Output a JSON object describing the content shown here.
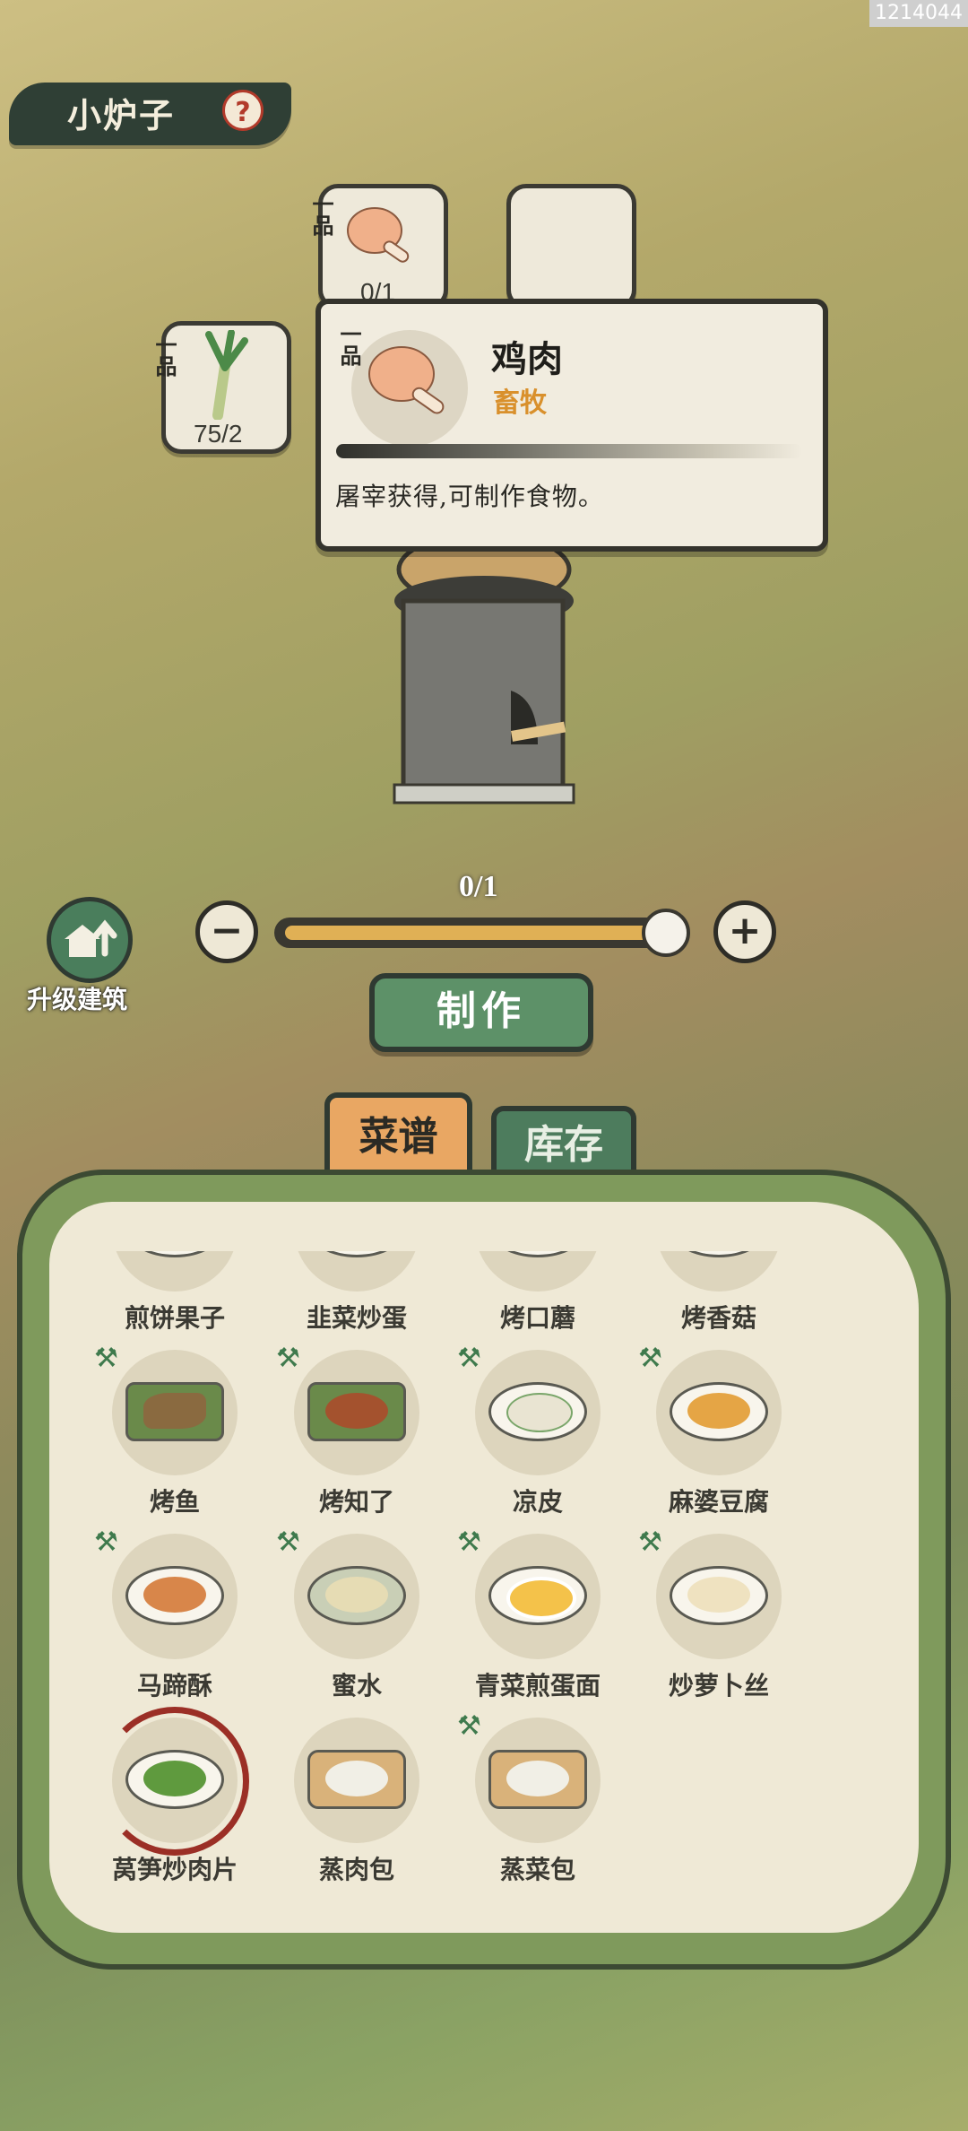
{
  "watermark": "1214044",
  "header": {
    "title": "小炉子",
    "help_icon": "help-icon"
  },
  "slots": [
    {
      "grade": "一品",
      "item": "鸡肉",
      "count": "0/1",
      "icon": "chicken-leg-icon"
    },
    {
      "grade": "",
      "item": "",
      "count": "",
      "icon": ""
    },
    {
      "grade": "一品",
      "item": "大葱",
      "count": "75/2",
      "icon": "leek-icon"
    }
  ],
  "tooltip": {
    "grade": "一品",
    "name": "鸡肉",
    "category": "畜牧",
    "description": "屠宰获得,可制作食物。",
    "icon": "chicken-leg-icon"
  },
  "controls": {
    "upgrade_label": "升级建筑",
    "quantity": "0/1",
    "quantity_fill": 1.0,
    "make_label": "制作",
    "minus_icon": "minus-icon",
    "plus_icon": "plus-icon"
  },
  "tabs": [
    {
      "label": "菜谱",
      "active": true
    },
    {
      "label": "库存",
      "active": false
    }
  ],
  "recipes": [
    {
      "name": "煎饼果子",
      "locked": false
    },
    {
      "name": "韭菜炒蛋",
      "locked": false
    },
    {
      "name": "烤口蘑",
      "locked": false
    },
    {
      "name": "烤香菇",
      "locked": false
    },
    {
      "name": "烤鱼",
      "locked": true
    },
    {
      "name": "烤知了",
      "locked": true
    },
    {
      "name": "凉皮",
      "locked": true
    },
    {
      "name": "麻婆豆腐",
      "locked": true
    },
    {
      "name": "马蹄酥",
      "locked": true
    },
    {
      "name": "蜜水",
      "locked": true
    },
    {
      "name": "青菜煎蛋面",
      "locked": true
    },
    {
      "name": "炒萝卜丝",
      "locked": true
    },
    {
      "name": "莴笋炒肉片",
      "locked": false,
      "selected": true
    },
    {
      "name": "蒸肉包",
      "locked": false
    },
    {
      "name": "蒸菜包",
      "locked": true
    }
  ],
  "colors": {
    "accent_green": "#5d9168",
    "tab_active": "#e9a763",
    "category_text": "#d9902c",
    "selected_ring": "#9b2f26"
  }
}
